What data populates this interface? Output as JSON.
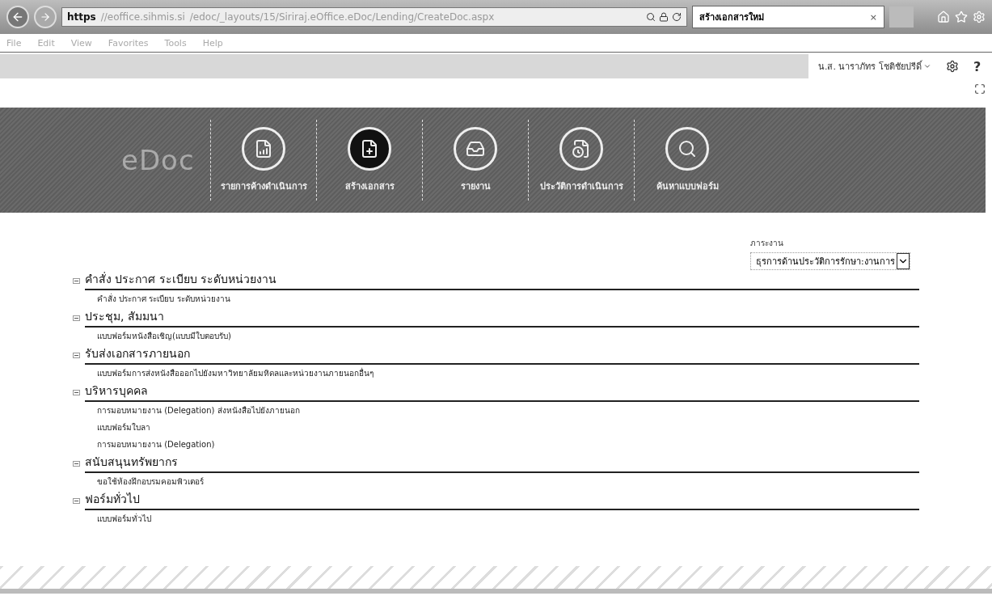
{
  "browser": {
    "url_scheme": "https",
    "url_host": "//eoffice.sihmis.si",
    "url_path": "/edoc/_layouts/15/Siriraj.eOffice.eDoc/Lending/CreateDoc.aspx",
    "tab_title": "สร้างเอกสารใหม่",
    "tab_close": "×",
    "menu": [
      "File",
      "Edit",
      "View",
      "Favorites",
      "Tools",
      "Help"
    ]
  },
  "suite_bar": {
    "user": "น.ส. นาราภัทร โชติชัยปรีดิ์",
    "help": "?"
  },
  "banner": {
    "logo": "eDoc",
    "nav": [
      {
        "label": "รายการค้างดำเนินการ",
        "selected": false,
        "kind": "pending"
      },
      {
        "label": "สร้างเอกสาร",
        "selected": true,
        "kind": "create"
      },
      {
        "label": "รายงาน",
        "selected": false,
        "kind": "report"
      },
      {
        "label": "ประวัติการดำเนินการ",
        "selected": false,
        "kind": "history"
      },
      {
        "label": "ค้นหาแบบฟอร์ม",
        "selected": false,
        "kind": "search"
      }
    ]
  },
  "workload": {
    "label": "ภาระงาน",
    "value": "ธุรการด้านประวัติการรักษา:งานการ"
  },
  "sections": [
    {
      "title": "คำสั่ง ประกาศ ระเบียบ ระดับหน่วยงาน",
      "expanded": true,
      "items": [
        "คำสั่ง ประกาศ ระเบียบ ระดับหน่วยงาน"
      ]
    },
    {
      "title": "ประชุม, สัมมนา",
      "expanded": true,
      "items": [
        "แบบฟอร์มหนังสือเชิญ(แบบมีใบตอบรับ)"
      ]
    },
    {
      "title": "รับส่งเอกสารภายนอก",
      "expanded": true,
      "items": [
        "แบบฟอร์มการส่งหนังสือออกไปยังมหาวิทยาลัยมหิดลและหน่วยงานภายนอกอื่นๆ"
      ]
    },
    {
      "title": "บริหารบุคคล",
      "expanded": true,
      "items": [
        "การมอบหมายงาน (Delegation) ส่งหนังสือไปยังภายนอก",
        "แบบฟอร์มใบลา",
        "การมอบหมายงาน (Delegation)"
      ]
    },
    {
      "title": "สนับสนุนทรัพยากร",
      "expanded": true,
      "items": [
        "ขอใช้ห้องฝึกอบรมคอมพิวเตอร์"
      ]
    },
    {
      "title": "ฟอร์มทั่วไป",
      "expanded": true,
      "items": [
        "แบบฟอร์มทั่วไป"
      ]
    }
  ]
}
